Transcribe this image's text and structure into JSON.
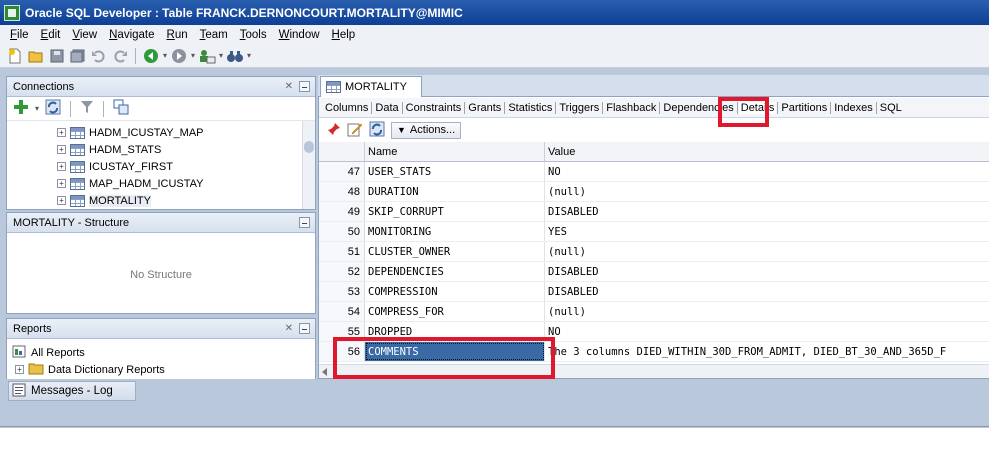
{
  "window": {
    "title": "Oracle SQL Developer : Table FRANCK.DERNONCOURT.MORTALITY@MIMIC"
  },
  "menu": [
    {
      "u": "F",
      "rest": "ile"
    },
    {
      "u": "E",
      "rest": "dit"
    },
    {
      "u": "V",
      "rest": "iew"
    },
    {
      "u": "N",
      "rest": "avigate"
    },
    {
      "u": "R",
      "rest": "un"
    },
    {
      "u": "T",
      "rest": "eam"
    },
    {
      "u": "T",
      "rest": "ools"
    },
    {
      "u": "W",
      "rest": "indow"
    },
    {
      "u": "H",
      "rest": "elp"
    }
  ],
  "connections": {
    "title": "Connections",
    "items": [
      "HADM_ICUSTAY_MAP",
      "HADM_STATS",
      "ICUSTAY_FIRST",
      "MAP_HADM_ICUSTAY",
      "MORTALITY"
    ]
  },
  "structure": {
    "title": "MORTALITY - Structure",
    "empty_text": "No Structure"
  },
  "reports": {
    "title": "Reports",
    "items": [
      "All Reports",
      "Data Dictionary Reports"
    ]
  },
  "editor": {
    "tab_label": "MORTALITY",
    "subtabs": [
      "Columns",
      "Data",
      "Constraints",
      "Grants",
      "Statistics",
      "Triggers",
      "Flashback",
      "Dependencies",
      "Details",
      "Partitions",
      "Indexes",
      "SQL"
    ],
    "active_subtab": "Details",
    "actions_label": "Actions...",
    "columns": {
      "name": "Name",
      "value": "Value"
    },
    "rows": [
      {
        "num": "47",
        "name": "USER_STATS",
        "value": "NO"
      },
      {
        "num": "48",
        "name": "DURATION",
        "value": "(null)"
      },
      {
        "num": "49",
        "name": "SKIP_CORRUPT",
        "value": "DISABLED"
      },
      {
        "num": "50",
        "name": "MONITORING",
        "value": "YES"
      },
      {
        "num": "51",
        "name": "CLUSTER_OWNER",
        "value": "(null)"
      },
      {
        "num": "52",
        "name": "DEPENDENCIES",
        "value": "DISABLED"
      },
      {
        "num": "53",
        "name": "COMPRESSION",
        "value": "DISABLED"
      },
      {
        "num": "54",
        "name": "COMPRESS_FOR",
        "value": "(null)"
      },
      {
        "num": "55",
        "name": "DROPPED",
        "value": "NO"
      },
      {
        "num": "56",
        "name": "COMMENTS",
        "value": "The 3 columns DIED_WITHIN_30D_FROM_ADMIT, DIED_BT_30_AND_365D_F"
      }
    ]
  },
  "messages_log": {
    "label": "Messages - Log"
  },
  "colors": {
    "highlight": "#e0182d",
    "selection": "#3a6aa6",
    "titlebar": "#0d3f95"
  }
}
